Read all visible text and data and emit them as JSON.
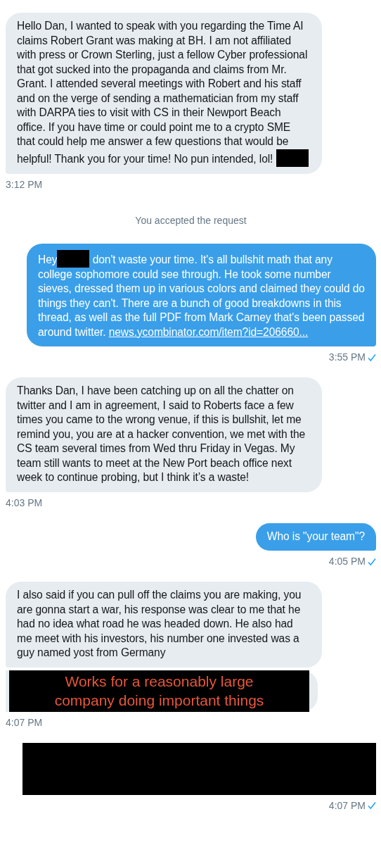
{
  "messages": [
    {
      "kind": "received",
      "parts": [
        {
          "kind": "text",
          "text": "Hello Dan, I wanted to speak with you regarding the Time AI claims Robert Grant was making at BH. I am not affiliated with press or Crown Sterling, just a fellow Cyber professional that got sucked into the propaganda and claims from Mr. Grant. I attended several meetings with Robert and his staff and on the verge of sending a mathematician from my staff with DARPA ties to visit with CS in their  Newport Beach office. If you have time or could point me to a crypto SME that could help me answer a few questions that would be helpful! Thank you for your time! No pun intended, lol! "
        },
        {
          "kind": "redaction"
        }
      ],
      "time": "3:12 PM"
    },
    {
      "kind": "system",
      "text": "You accepted the request"
    },
    {
      "kind": "sent",
      "parts": [
        {
          "kind": "text",
          "text": "Hey"
        },
        {
          "kind": "redaction"
        },
        {
          "kind": "text",
          "text": " don't waste your time. It's all bullshit math that any college sophomore could see through. He took some number sieves, dressed them up in various colors and claimed they could do things they can't. There are a bunch of good breakdowns in this thread, as well as the full PDF from Mark Carney that's been passed around twitter. "
        },
        {
          "kind": "link",
          "text": "news.ycombinator.com/item?id=206660..."
        }
      ],
      "time": "3:55 PM",
      "read": true
    },
    {
      "kind": "received",
      "parts": [
        {
          "kind": "text",
          "text": "Thanks Dan, I have been catching up on all the chatter on twitter and I am in agreement, I said to Roberts face a few times you came to the wrong venue, if this is bullshit, let me remind you, you are at a hacker convention, we met with the CS team several times from Wed thru Friday in Vegas.  My team still wants to meet at the New Port beach office next week to continue probing, but I think it’s a waste!"
        }
      ],
      "time": "4:03 PM"
    },
    {
      "kind": "sent",
      "parts": [
        {
          "kind": "text",
          "text": "Who is \"your team\"?"
        }
      ],
      "time": "4:05 PM",
      "read": true
    },
    {
      "kind": "received",
      "parts": [
        {
          "kind": "text",
          "text": "I also said if you can pull off the claims you are making, you are gonna start a war, his response was clear to me that he had no idea what road he was headed down. He also had me meet with his investors, his number one invested was a guy named yost from Germany"
        }
      ]
    },
    {
      "kind": "received_redacted",
      "text": "Works for a reasonably large company doing important things",
      "time": "4:07 PM"
    },
    {
      "kind": "sent_redacted",
      "time": "4:07 PM",
      "read": true
    }
  ]
}
